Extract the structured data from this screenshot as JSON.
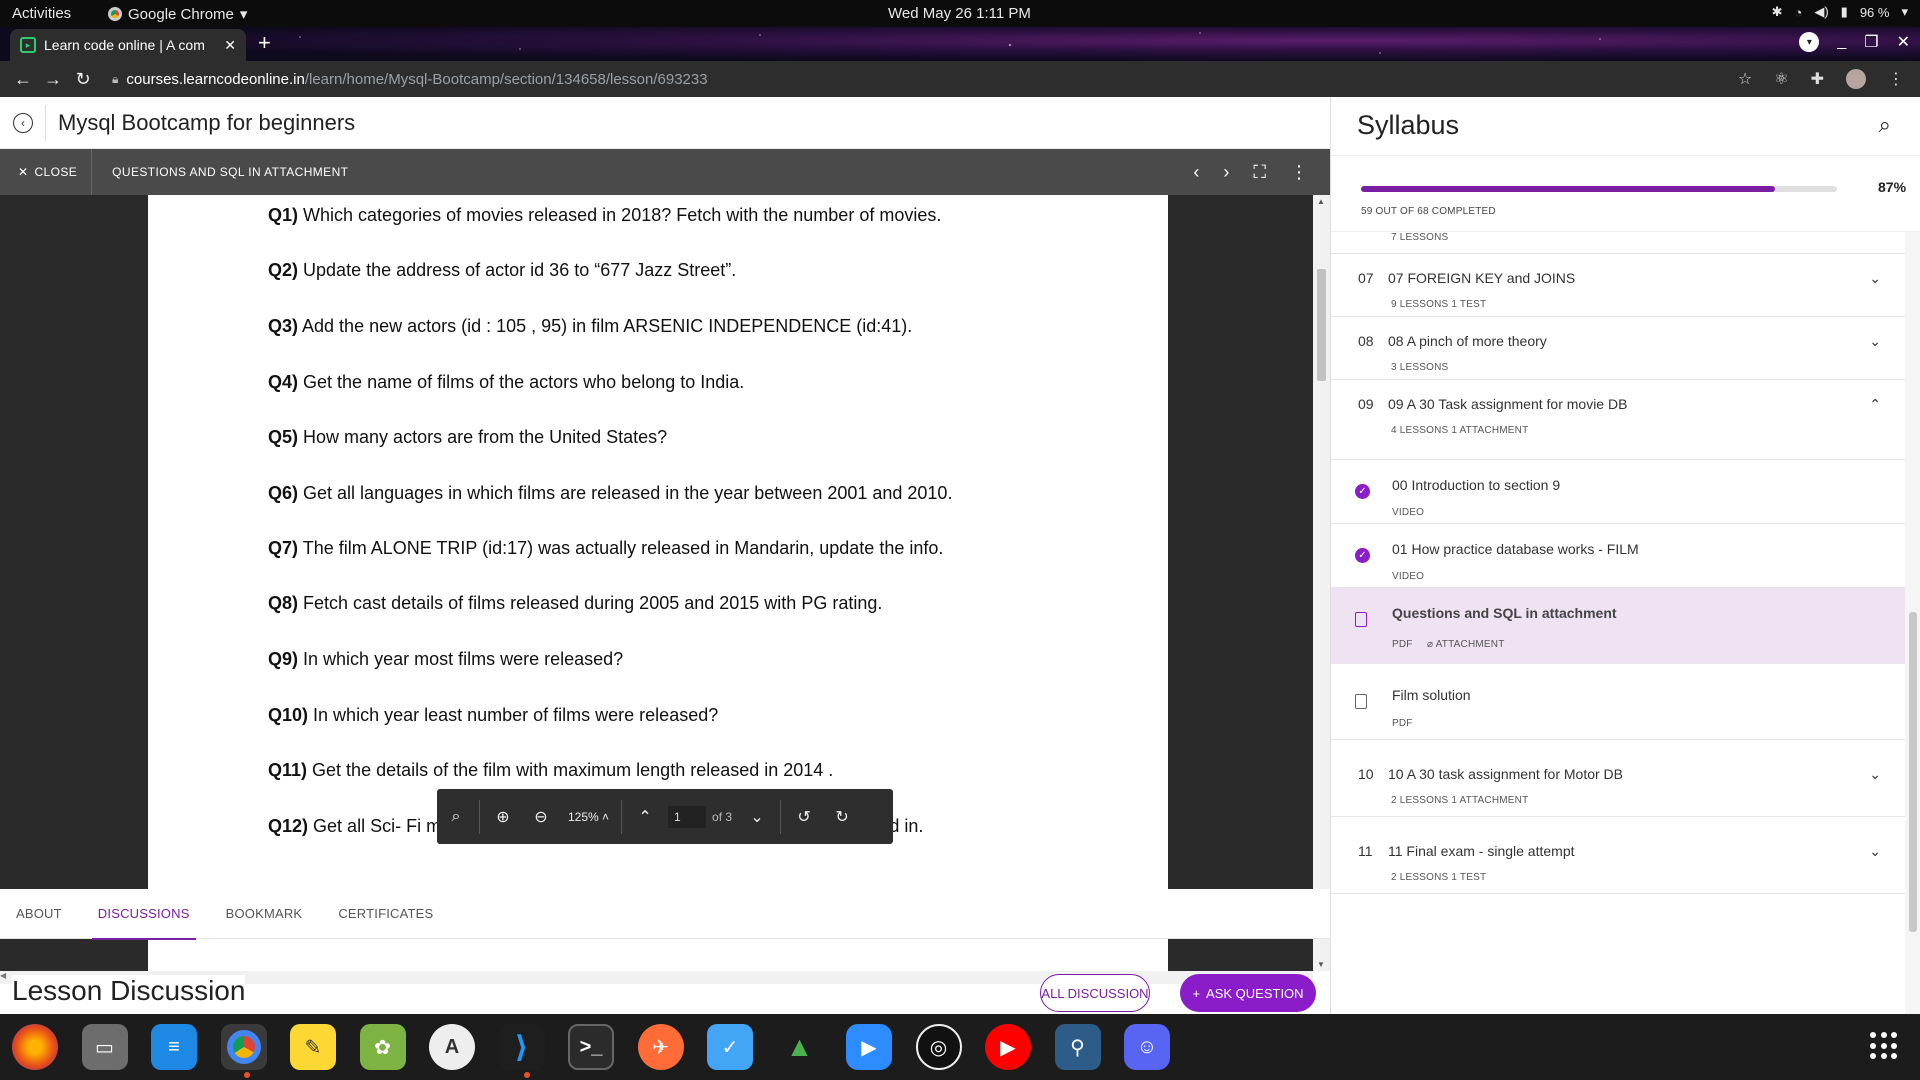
{
  "system": {
    "activities": "Activities",
    "app_name": "Google Chrome",
    "clock": "Wed May 26  1:11 PM",
    "battery": "96 %"
  },
  "browser": {
    "tab_title": "Learn code online | A com",
    "url_host": "courses.learncodeonline.in",
    "url_path": "/learn/home/Mysql-Bootcamp/section/134658/lesson/693233"
  },
  "course": {
    "title": "Mysql Bootcamp for beginners"
  },
  "viewer": {
    "close_label": "CLOSE",
    "document_name": "QUESTIONS AND SQL IN ATTACHMENT",
    "zoom": "125%",
    "page_input": "1",
    "page_total": "of 3"
  },
  "questions": [
    {
      "num": "Q1)",
      "text": "Which categories of movies released in 2018? Fetch with the number of movies."
    },
    {
      "num": "Q2)",
      "text": "Update the address of actor id 36 to “677 Jazz Street”."
    },
    {
      "num": "Q3)",
      "text": "Add the new actors (id : 105 , 95) in film  ARSENIC INDEPENDENCE (id:41)."
    },
    {
      "num": "Q4)",
      "text": "Get the name of films of the actors who belong to India."
    },
    {
      "num": "Q5)",
      "text": "How many actors are from the United States?"
    },
    {
      "num": "Q6)",
      "text": "Get all languages in which films are released in the year between 2001 and 2010."
    },
    {
      "num": "Q7)",
      "text": "The film ALONE TRIP (id:17) was actually released in Mandarin, update the info."
    },
    {
      "num": "Q8)",
      "text": "Fetch cast details of films released during 2005 and 2015 with PG rating."
    },
    {
      "num": "Q9)",
      "text": "In which year most films were released?"
    },
    {
      "num": "Q10)",
      "text": "In which year least number of films were released?"
    },
    {
      "num": "Q11)",
      "text": "Get the details of the film with maximum length released in 2014 ."
    },
    {
      "num": "Q12)",
      "text": "Get all Sci- Fi movies with NC-17 ratings and language they are screened in."
    }
  ],
  "lesson_tabs": [
    "ABOUT",
    "DISCUSSIONS",
    "BOOKMARK",
    "CERTIFICATES"
  ],
  "discussion": {
    "title": "Lesson Discussion",
    "all_discussion": "ALL DISCUSSION",
    "ask_question": "ASK QUESTION"
  },
  "syllabus": {
    "title": "Syllabus",
    "progress_percent": 87,
    "progress_label": "87%",
    "progress_text": "59 OUT OF 68 COMPLETED",
    "partial_meta": "7 LESSONS",
    "sections": [
      {
        "num": "07",
        "name": "07 FOREIGN KEY and JOINS",
        "meta": "9 LESSONS   1 TEST",
        "expanded": false
      },
      {
        "num": "08",
        "name": "08 A pinch of more theory",
        "meta": "3 LESSONS",
        "expanded": false
      },
      {
        "num": "09",
        "name": "09 A 30 Task assignment for movie DB",
        "meta": "4 LESSONS   1 ATTACHMENT",
        "expanded": true
      },
      {
        "num": "10",
        "name": "10 A 30 task assignment for Motor DB",
        "meta": "2 LESSONS   1 ATTACHMENT",
        "expanded": false
      },
      {
        "num": "11",
        "name": "11 Final exam - single attempt",
        "meta": "2 LESSONS   1 TEST",
        "expanded": false
      }
    ],
    "lessons": [
      {
        "name": "00 Introduction to section 9",
        "meta": "VIDEO",
        "status": "completed"
      },
      {
        "name": "01 How practice database works - FILM",
        "meta": "VIDEO",
        "status": "completed"
      },
      {
        "name": "Questions and SQL in attachment",
        "meta": "PDF",
        "attachment": "ATTACHMENT",
        "status": "current"
      },
      {
        "name": "Film solution",
        "meta": "PDF",
        "status": "pending"
      }
    ]
  },
  "colors": {
    "accent": "#7b1fa2",
    "accent_button": "#8b1cc9",
    "viewer_bar": "#4a4a4a"
  },
  "dock_apps": [
    "firefox",
    "files",
    "writer",
    "chrome",
    "text-editor",
    "gimp",
    "software-updater",
    "vscode",
    "terminal",
    "postman",
    "tasks",
    "inkscape",
    "zoom",
    "obs",
    "youtube-music",
    "mysql-workbench",
    "discord"
  ]
}
